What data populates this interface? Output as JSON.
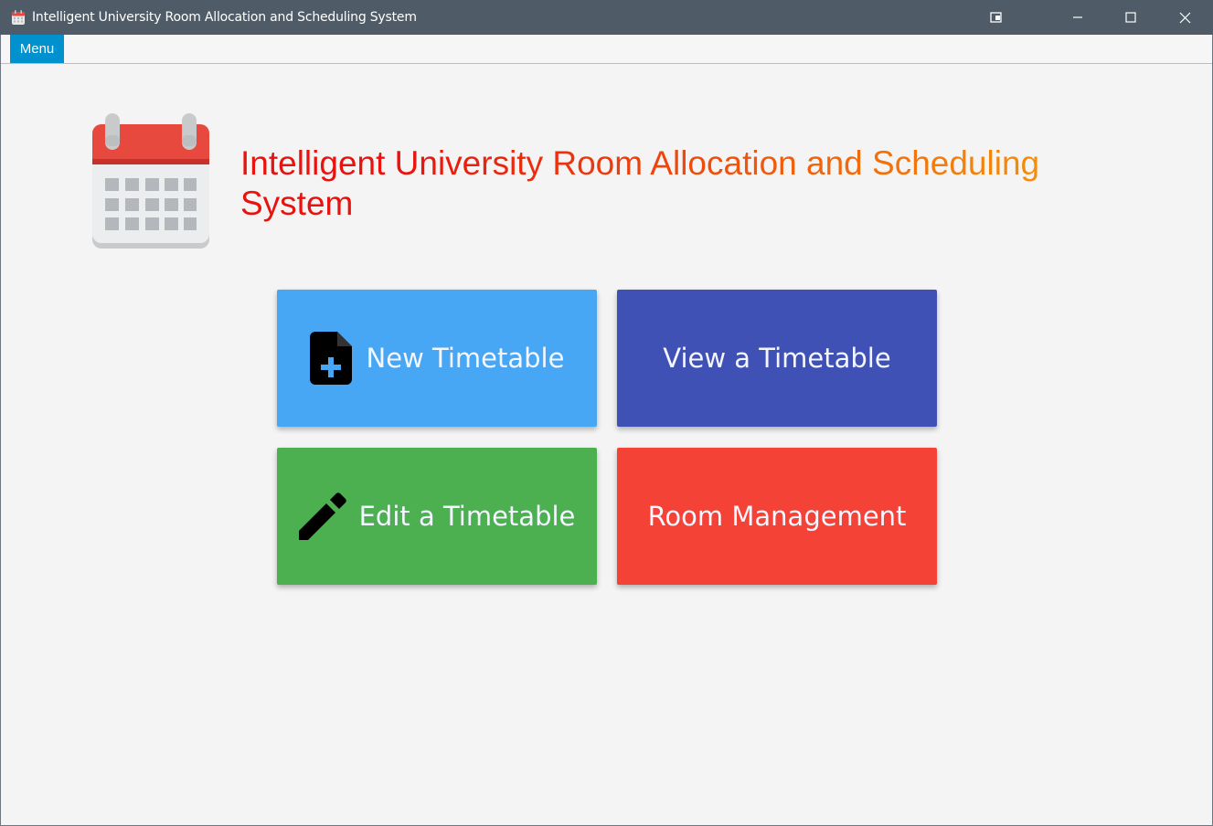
{
  "window": {
    "title": "Intelligent University Room Allocation and Scheduling System",
    "titlebar_color": "#4f5b66"
  },
  "menubar": {
    "menu_label": "Menu",
    "accent": "#0091ce"
  },
  "header": {
    "title_segments": [
      {
        "text": "Intelligent University Room Allocation and Scheduling",
        "colors": [
          "#e8130e",
          "#f58e0a"
        ]
      },
      {
        "text": "System",
        "color": "#e8130e"
      }
    ],
    "logo_icon": "calendar-icon"
  },
  "tiles": [
    {
      "label": "New Timetable",
      "icon": "new-document-icon",
      "color": "#47a7f4"
    },
    {
      "label": "View a Timetable",
      "icon": null,
      "color": "#3f51b5"
    },
    {
      "label": "Edit a Timetable",
      "icon": "pencil-icon",
      "color": "#4caf50"
    },
    {
      "label": "Room Management",
      "icon": null,
      "color": "#f44236"
    }
  ]
}
